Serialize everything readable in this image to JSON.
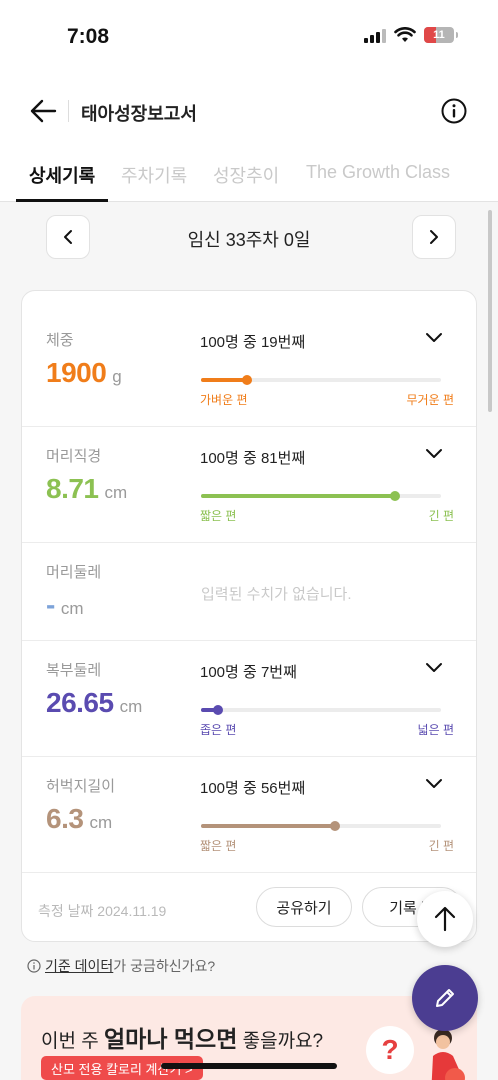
{
  "status_bar": {
    "time": "7:08",
    "battery": "11"
  },
  "header": {
    "title": "태아성장보고서"
  },
  "tabs": [
    {
      "label": "상세기록",
      "active": true
    },
    {
      "label": "주차기록",
      "active": false
    },
    {
      "label": "성장추이",
      "active": false
    },
    {
      "label": "The Growth Class",
      "active": false
    }
  ],
  "week_nav": {
    "title": "임신 33주차 0일"
  },
  "metrics": [
    {
      "label": "체중",
      "value": "1900",
      "unit": "g",
      "rank": "100명 중 19번째",
      "percentile": 0.19,
      "color": "#f07d1a",
      "scale_left": "가벼운 편",
      "scale_right": "무거운 편"
    },
    {
      "label": "머리직경",
      "value": "8.71",
      "unit": "cm",
      "rank": "100명 중 81번째",
      "percentile": 0.81,
      "color": "#8cc152",
      "scale_left": "짧은 편",
      "scale_right": "긴 편"
    },
    {
      "label": "머리둘레",
      "value": "-",
      "unit": "cm",
      "empty_text": "입력된 수치가 없습니다.",
      "color": "#7da3d9"
    },
    {
      "label": "복부둘레",
      "value": "26.65",
      "unit": "cm",
      "rank": "100명 중 7번째",
      "percentile": 0.07,
      "color": "#5a4bb0",
      "scale_left": "좁은 편",
      "scale_right": "넓은 편"
    },
    {
      "label": "허벅지길이",
      "value": "6.3",
      "unit": "cm",
      "rank": "100명 중 56번째",
      "percentile": 0.56,
      "color": "#b4937a",
      "scale_left": "짧은 편",
      "scale_right": "긴 편"
    }
  ],
  "footer": {
    "date": "측정 날짜 2024.11.19",
    "share_label": "공유하기",
    "edit_label": "기록 편"
  },
  "help": {
    "link": "기준 데이터",
    "suffix": "가 궁금하신가요?"
  },
  "banner": {
    "title_pre": "이번 주 ",
    "title_bold": "얼마나 먹으면",
    "title_post": " 좋을까요?",
    "pill": "산모 전용 칼로리 계산기 >",
    "bubble": "?"
  }
}
